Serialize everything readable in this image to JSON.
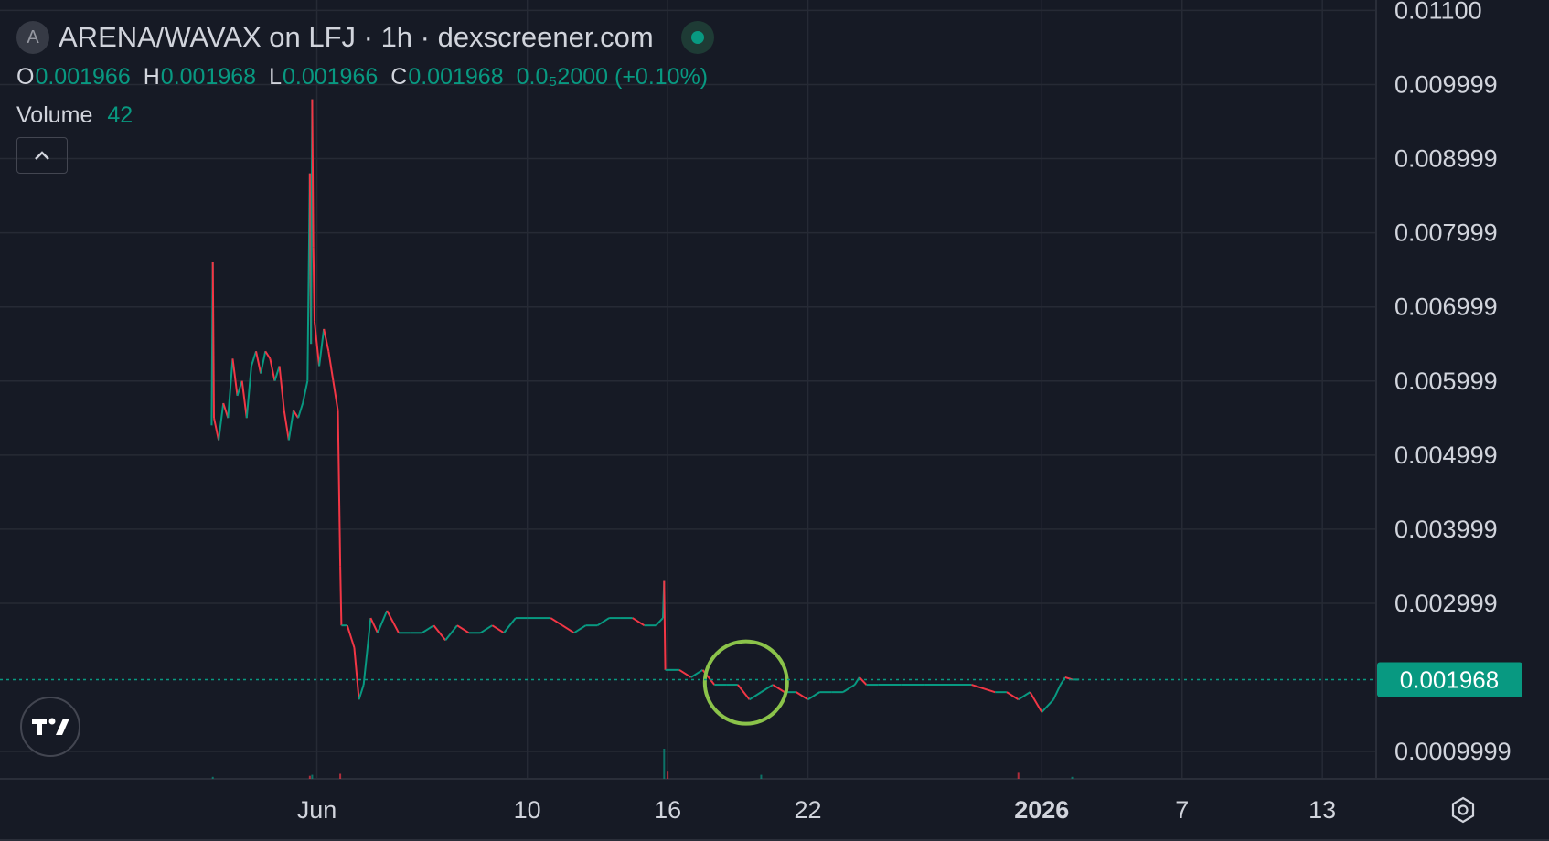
{
  "header": {
    "logo_letter": "A",
    "title": "ARENA/WAVAX on LFJ · 1h · dexscreener.com",
    "ohlc": {
      "o_label": "O",
      "o_value": "0.001966",
      "h_label": "H",
      "h_value": "0.001968",
      "l_label": "L",
      "l_value": "0.001966",
      "c_label": "C",
      "c_value": "0.001968",
      "change": "0.0₅2000 (+0.10%)"
    },
    "volume_label": "Volume",
    "volume_value": "42"
  },
  "colors": {
    "background": "#161a25",
    "grid": "#262a35",
    "up": "#089981",
    "down": "#f23645",
    "axis_text": "#d1d4dc",
    "highlight_circle": "#8bc34a",
    "last_price_bg": "#089981"
  },
  "icons": {
    "collapse": "chevron-up-icon",
    "brand": "tradingview-logo-icon",
    "settings": "gear-icon",
    "live": "live-status-dot-icon"
  },
  "chart_data": {
    "type": "line",
    "title": "ARENA/WAVAX on LFJ · 1h · dexscreener.com",
    "xlabel": "",
    "ylabel": "",
    "grid": true,
    "y_ticks": [
      "0.01100",
      "0.009999",
      "0.008999",
      "0.007999",
      "0.006999",
      "0.005999",
      "0.004999",
      "0.003999",
      "0.002999",
      "0.0009999"
    ],
    "y_tick_values": [
      0.011,
      0.009999,
      0.008999,
      0.007999,
      0.006999,
      0.005999,
      0.004999,
      0.003999,
      0.002999,
      0.0009999
    ],
    "x_ticks": [
      "Jun",
      "10",
      "16",
      "22",
      "2026",
      "7",
      "13"
    ],
    "x_tick_days": [
      0,
      9,
      15,
      21,
      31,
      37,
      43
    ],
    "ylim": [
      0.00063,
      0.01114
    ],
    "xlim_days": [
      -13.55,
      45.3
    ],
    "last_price": {
      "label": "0.001968",
      "value": 0.001968
    },
    "series": [
      {
        "values": [
          [
            -4.5,
            0.0054
          ],
          [
            -4.45,
            0.0076
          ],
          [
            -4.4,
            0.0055
          ],
          [
            -4.2,
            0.0052
          ],
          [
            -4.0,
            0.0057
          ],
          [
            -3.8,
            0.0055
          ],
          [
            -3.6,
            0.0063
          ],
          [
            -3.4,
            0.0058
          ],
          [
            -3.2,
            0.006
          ],
          [
            -3.0,
            0.0055
          ],
          [
            -2.8,
            0.0062
          ],
          [
            -2.6,
            0.0064
          ],
          [
            -2.4,
            0.0061
          ],
          [
            -2.2,
            0.0064
          ],
          [
            -2.0,
            0.0063
          ],
          [
            -1.8,
            0.006
          ],
          [
            -1.6,
            0.0062
          ],
          [
            -1.4,
            0.0056
          ],
          [
            -1.2,
            0.0052
          ],
          [
            -1.0,
            0.0056
          ],
          [
            -0.8,
            0.0055
          ],
          [
            -0.6,
            0.0057
          ],
          [
            -0.4,
            0.006
          ],
          [
            -0.3,
            0.0088
          ],
          [
            -0.25,
            0.0065
          ],
          [
            -0.2,
            0.0098
          ],
          [
            -0.15,
            0.0078
          ],
          [
            -0.1,
            0.0068
          ],
          [
            0.1,
            0.0062
          ],
          [
            0.3,
            0.0067
          ],
          [
            0.5,
            0.0064
          ],
          [
            0.7,
            0.006
          ],
          [
            0.9,
            0.0056
          ],
          [
            1.0,
            0.0035
          ],
          [
            1.05,
            0.0027
          ],
          [
            1.3,
            0.0027
          ],
          [
            1.6,
            0.0024
          ],
          [
            1.8,
            0.0017
          ],
          [
            2.0,
            0.0019
          ],
          [
            2.3,
            0.0028
          ],
          [
            2.6,
            0.0026
          ],
          [
            3.0,
            0.0029
          ],
          [
            3.5,
            0.0026
          ],
          [
            4.0,
            0.0026
          ],
          [
            4.5,
            0.0026
          ],
          [
            5.0,
            0.0027
          ],
          [
            5.5,
            0.0025
          ],
          [
            6.0,
            0.0027
          ],
          [
            6.5,
            0.0026
          ],
          [
            7.0,
            0.0026
          ],
          [
            7.5,
            0.0027
          ],
          [
            8.0,
            0.0026
          ],
          [
            8.5,
            0.0028
          ],
          [
            9.0,
            0.0028
          ],
          [
            9.5,
            0.0028
          ],
          [
            10.0,
            0.0028
          ],
          [
            10.5,
            0.0027
          ],
          [
            11.0,
            0.0026
          ],
          [
            11.5,
            0.0027
          ],
          [
            12.0,
            0.0027
          ],
          [
            12.5,
            0.0028
          ],
          [
            13.0,
            0.0028
          ],
          [
            13.5,
            0.0028
          ],
          [
            14.0,
            0.0027
          ],
          [
            14.5,
            0.0027
          ],
          [
            14.8,
            0.0028
          ],
          [
            14.85,
            0.0033
          ],
          [
            14.9,
            0.0021
          ],
          [
            15.5,
            0.0021
          ],
          [
            16.0,
            0.002
          ],
          [
            16.5,
            0.0021
          ],
          [
            17.0,
            0.0019
          ],
          [
            17.5,
            0.0019
          ],
          [
            18.0,
            0.0019
          ],
          [
            18.5,
            0.0017
          ],
          [
            19.0,
            0.0018
          ],
          [
            19.5,
            0.0019
          ],
          [
            20.0,
            0.0018
          ],
          [
            20.5,
            0.0018
          ],
          [
            21.0,
            0.0017
          ],
          [
            21.5,
            0.0018
          ],
          [
            22.0,
            0.0018
          ],
          [
            22.5,
            0.0018
          ],
          [
            23.0,
            0.0019
          ],
          [
            23.2,
            0.002
          ],
          [
            23.5,
            0.0019
          ],
          [
            24.0,
            0.0019
          ],
          [
            25.0,
            0.0019
          ],
          [
            26.0,
            0.0019
          ],
          [
            27.0,
            0.0019
          ],
          [
            28.0,
            0.0019
          ],
          [
            29.0,
            0.0018
          ],
          [
            29.5,
            0.0018
          ],
          [
            30.0,
            0.0017
          ],
          [
            30.5,
            0.0018
          ],
          [
            31.0,
            0.00153
          ],
          [
            31.5,
            0.0017
          ],
          [
            31.8,
            0.0019
          ],
          [
            32.0,
            0.002
          ],
          [
            32.3,
            0.00197
          ],
          [
            32.6,
            0.00197
          ]
        ]
      }
    ],
    "volume": [
      [
        -4.45,
        2
      ],
      [
        -0.3,
        3
      ],
      [
        -0.2,
        4
      ],
      [
        1.0,
        5
      ],
      [
        14.85,
        30
      ],
      [
        15.0,
        8
      ],
      [
        19.0,
        4
      ],
      [
        30.0,
        6
      ],
      [
        32.3,
        2
      ]
    ],
    "annotations": [
      {
        "shape": "circle",
        "x_day": 18.35,
        "y": 0.00193
      }
    ]
  }
}
